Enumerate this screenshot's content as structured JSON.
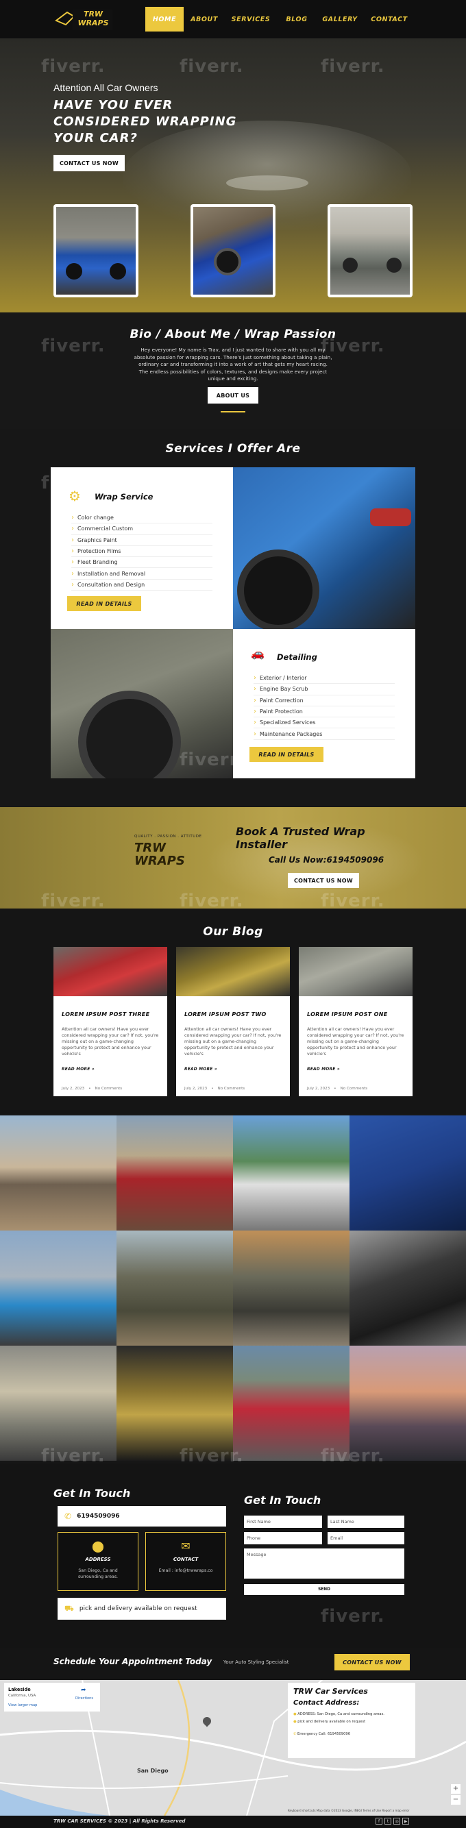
{
  "header": {
    "logo_text": "TRW WRAPS",
    "nav": [
      "HOME",
      "ABOUT",
      "SERVICES",
      "BLOG",
      "GALLERY",
      "CONTACT"
    ]
  },
  "watermark": "fiverr.",
  "hero": {
    "eyebrow": "Attention All Car Owners",
    "headline": "HAVE YOU EVER CONSIDERED WRAPPING YOUR CAR?",
    "cta": "CONTACT US NOW"
  },
  "bio": {
    "title": "Bio / About Me / Wrap Passion",
    "text": "Hey everyone! My name is Trav, and I just wanted to share with you all my absolute passion for wrapping cars. There's just something about taking a plain, ordinary car and transforming it into a work of art that gets my heart racing. The endless possibilities of colors, textures, and designs make every project unique and exciting.",
    "button": "ABOUT US"
  },
  "services": {
    "title": "Services I Offer Are",
    "wrap": {
      "title": "Wrap Service",
      "items": [
        "Color change",
        "Commercial Custom",
        "Graphics Paint",
        "Protection Films",
        "Fleet Branding",
        "Installation and Removal",
        "Consultation and Design"
      ],
      "button": "READ IN DETAILS"
    },
    "detailing": {
      "title": "Detailing",
      "items": [
        "Exterior / Interior",
        "Engine Bay Scrub",
        "Paint Correction",
        "Paint Protection",
        "Specialized Services",
        "Maintenance Packages"
      ],
      "button": "READ IN DETAILS"
    }
  },
  "book": {
    "logo_tag": "QUALITY . PASSION . ATTITUDE",
    "title": "Book A Trusted Wrap Installer",
    "call_label": "Call Us Now:",
    "phone": "6194509096",
    "button": "CONTACT US NOW"
  },
  "blog": {
    "title": "Our Blog",
    "posts": [
      {
        "title": "LOREM IPSUM POST THREE",
        "excerpt": "Attention all car owners! Have you ever considered wrapping your car? If not, you're missing out on a game-changing opportunity to protect and enhance your vehicle's",
        "more": "READ MORE »",
        "date": "July 2, 2023",
        "comments": "No Comments"
      },
      {
        "title": "LOREM IPSUM POST TWO",
        "excerpt": "Attention all car owners! Have you ever considered wrapping your car? If not, you're missing out on a game-changing opportunity to protect and enhance your vehicle's",
        "more": "READ MORE »",
        "date": "July 2, 2023",
        "comments": "No Comments"
      },
      {
        "title": "LOREM IPSUM POST ONE",
        "excerpt": "Attention all car owners! Have you ever considered wrapping your car? If not, you're missing out on a game-changing opportunity to protect and enhance your vehicle's",
        "more": "READ MORE »",
        "date": "July 2, 2023",
        "comments": "No Comments"
      }
    ]
  },
  "contact": {
    "left_title": "Get In Touch",
    "phone": "6194509096",
    "address_label": "ADDRESS",
    "address_text": "San Diego, Ca and surrounding areas.",
    "contact_label": "CONTACT",
    "contact_text": "Email : info@trwwraps.co",
    "pickup": "pick and delivery available on request",
    "form_title": "Get In Touch",
    "first_name": "First Name",
    "last_name": "Last Name",
    "phone_ph": "Phone",
    "email_ph": "Email",
    "message_ph": "Message",
    "send": "SEND"
  },
  "schedule": {
    "title": "Schedule Your Appointment Today",
    "sub": "Your Auto Styling Specialist",
    "button": "CONTACT US NOW"
  },
  "map": {
    "place": "Lakeside",
    "place_sub": "California, USA",
    "directions": "Directions",
    "view_larger": "View larger map",
    "city_label": "San Diego",
    "card_title": "TRW Car Services",
    "card_sub": "Contact Address:",
    "card_address": "ADDRESS: San Diego, Ca and surrounding areas.",
    "card_pickup": "pick and delivery available on request",
    "card_phone": "Emergency Call: 6194509096",
    "attribution": "Keyboard shortcuts   Map data ©2023 Google, INEGI   Terms of Use   Report a map error"
  },
  "footer": {
    "copyright": "TRW CAR SERVICES © 2023 | All Rights Reserved"
  },
  "colors": {
    "accent": "#ecc83e",
    "dark": "#151515",
    "white": "#ffffff"
  }
}
